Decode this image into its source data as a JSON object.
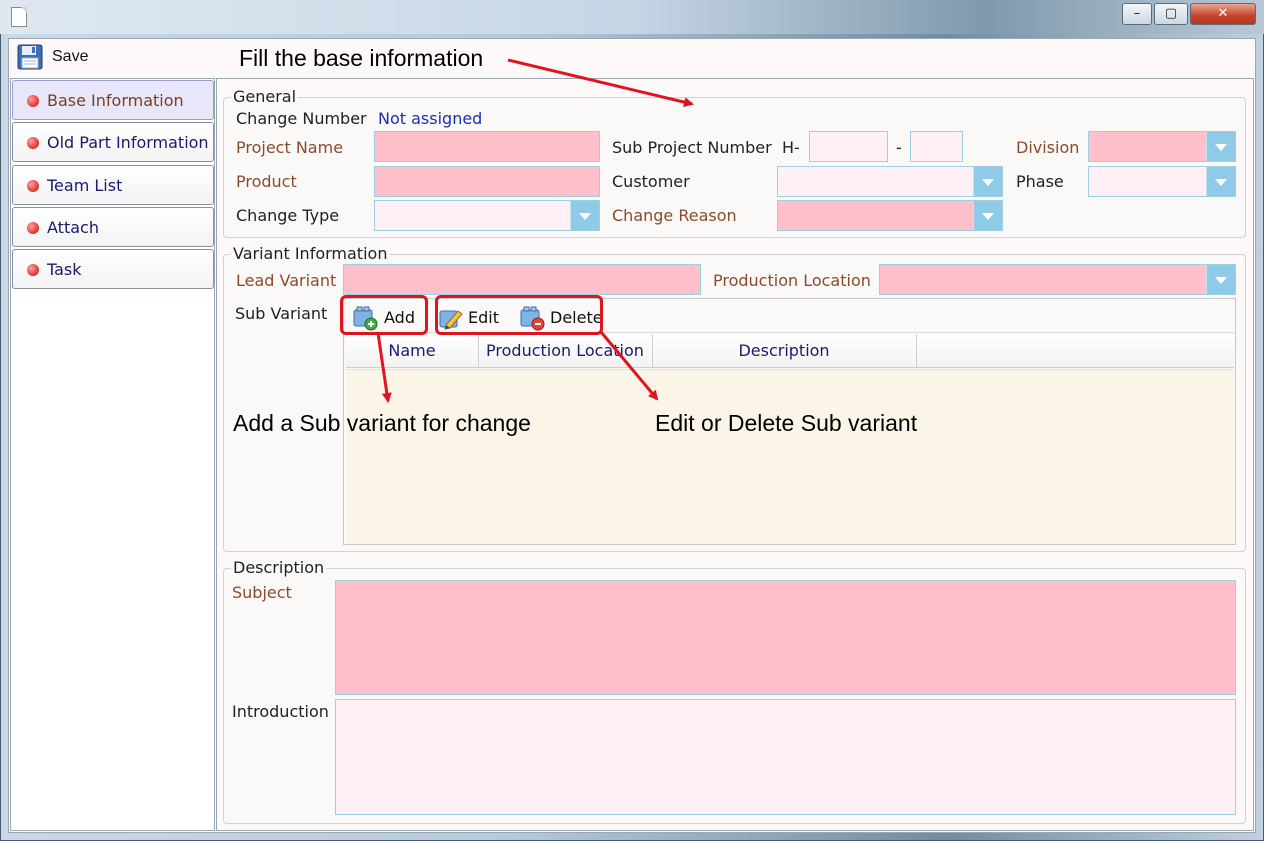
{
  "window": {
    "minimize": "–",
    "maximize": "▢",
    "close": "✕"
  },
  "toolbar": {
    "save_label": "Save",
    "save_icon": "floppy-disk-icon"
  },
  "sidebar": {
    "items": [
      {
        "label": "Base Information",
        "active": true
      },
      {
        "label": "Old Part Information",
        "active": false
      },
      {
        "label": "Team List",
        "active": false
      },
      {
        "label": "Attach",
        "active": false
      },
      {
        "label": "Task",
        "active": false
      }
    ]
  },
  "general": {
    "title": "General",
    "change_number_label": "Change Number",
    "change_number_value": "Not assigned",
    "project_name_label": "Project Name",
    "sub_project_number_label": "Sub Project Number",
    "sub_project_prefix": "H-",
    "sub_project_separator": "-",
    "division_label": "Division",
    "product_label": "Product",
    "customer_label": "Customer",
    "phase_label": "Phase",
    "change_type_label": "Change Type",
    "change_reason_label": "Change Reason"
  },
  "variant": {
    "title": "Variant Information",
    "lead_variant_label": "Lead Variant",
    "production_location_label": "Production Location",
    "sub_variant_label": "Sub Variant",
    "add_label": "Add",
    "edit_label": "Edit",
    "delete_label": "Delete",
    "columns": [
      "Name",
      "Production Location",
      "Description"
    ]
  },
  "description": {
    "title": "Description",
    "subject_label": "Subject",
    "introduction_label": "Introduction"
  },
  "annotations": {
    "fill_base": "Fill the base information",
    "add_sub": "Add a Sub variant for change",
    "edit_delete": "Edit or Delete Sub variant"
  },
  "colors": {
    "required_field": "#ffc0cb",
    "optional_field": "#fff0f5",
    "dropdown_arrow": "#8fcbe8",
    "annotation_red": "#e0141e",
    "required_label": "#8a4b2a"
  }
}
